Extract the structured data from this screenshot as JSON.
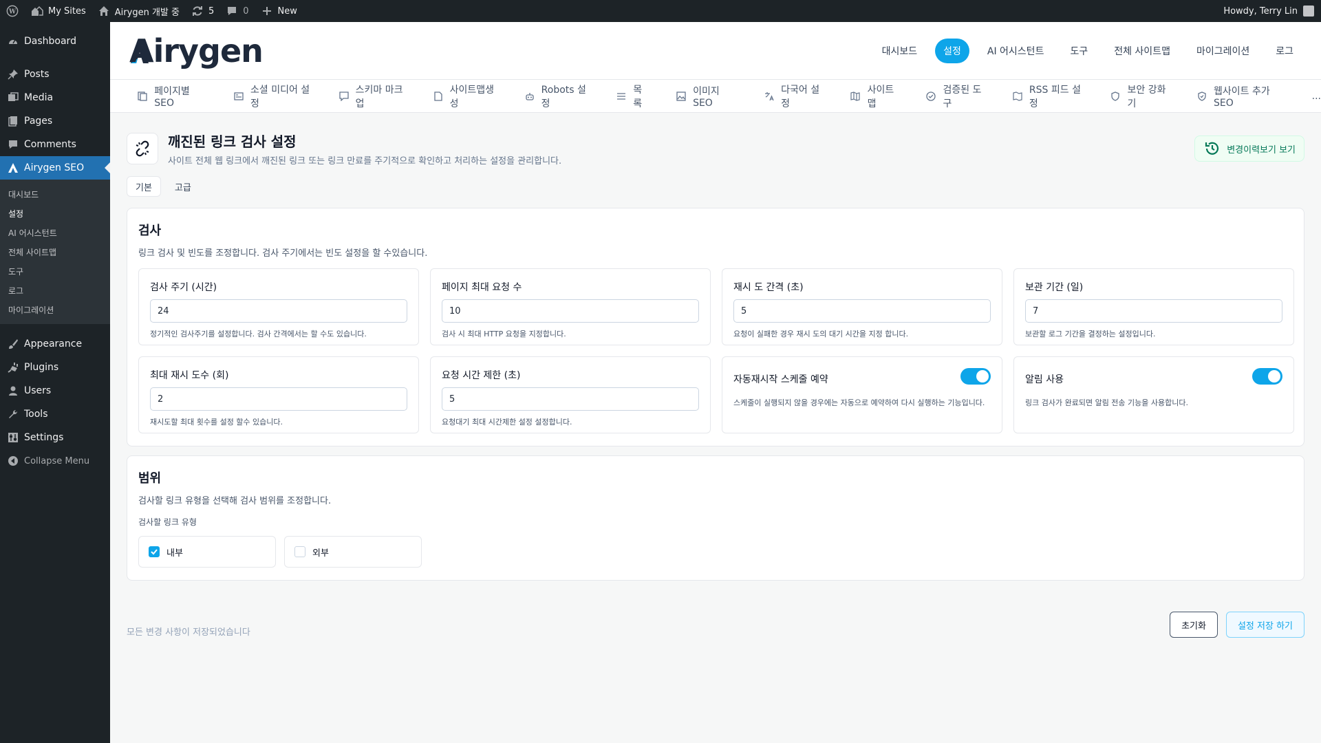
{
  "adminbar": {
    "my_sites": "My Sites",
    "site_name": "Airygen 개발 중",
    "updates_count": "5",
    "comments_count": "0",
    "new_label": "New",
    "howdy": "Howdy, Terry Lin"
  },
  "sidebar": {
    "items": [
      {
        "label": "Dashboard",
        "icon": "dashboard-icon"
      },
      {
        "label": "Posts",
        "icon": "pin-icon"
      },
      {
        "label": "Media",
        "icon": "media-icon"
      },
      {
        "label": "Pages",
        "icon": "page-icon"
      },
      {
        "label": "Comments",
        "icon": "comment-icon"
      },
      {
        "label": "Airygen SEO",
        "icon": "airygen-icon"
      }
    ],
    "submenu": [
      "대시보드",
      "설정",
      "AI 어시스턴트",
      "전체 사이트맵",
      "도구",
      "로그",
      "마이그레이션"
    ],
    "items_bottom": [
      {
        "label": "Appearance",
        "icon": "brush-icon"
      },
      {
        "label": "Plugins",
        "icon": "plugin-icon"
      },
      {
        "label": "Users",
        "icon": "user-icon"
      },
      {
        "label": "Tools",
        "icon": "wrench-icon"
      },
      {
        "label": "Settings",
        "icon": "settings-icon"
      },
      {
        "label": "Collapse Menu",
        "icon": "collapse-icon"
      }
    ]
  },
  "header": {
    "logo": "Airygen",
    "nav": [
      "대시보드",
      "설정",
      "AI 어시스턴트",
      "도구",
      "전체 사이트맵",
      "마이그레이션",
      "로그"
    ],
    "active_nav_index": 1
  },
  "tabs": [
    "페이지별 SEO",
    "소셜 미디어 설정",
    "스키마 마크업",
    "사이트맵생성",
    "Robots 설정",
    "목록",
    "이미지 SEO",
    "다국어 설정",
    "사이트맵",
    "검증된 도구",
    "RSS 피드 설정",
    "보안 강화기",
    "웹사이트 추가 SEO",
    "..."
  ],
  "page": {
    "title": "깨진된 링크 검사 설정",
    "description": "사이트 전체 웹 링크에서 깨진된 링크 또는 링크 만료를 주기적으로 확인하고 처리하는 설정을 관리합니다.",
    "history_button": "변경이력보기 보기"
  },
  "mode_tabs": [
    "기본",
    "고급"
  ],
  "scan_card": {
    "title": "검사",
    "description": "링크 검사 및 빈도를 조정합니다. 검사 주기에서는 빈도 설정을 할 수있습니다.",
    "fields": [
      {
        "label": "검사 주기 (시간)",
        "value": "24",
        "help": "정기적인 검사주기를 설정합니다. 검사 간격에서는 할 수도 있습니다."
      },
      {
        "label": "페이지 최대 요청 수",
        "value": "10",
        "help": "검사 시 최대 HTTP 요청을 지정합니다."
      },
      {
        "label": "재시 도 간격 (초)",
        "value": "5",
        "help": "요청이 실패한 경우 재시 도의 대기 시간을 지정 합니다."
      },
      {
        "label": "보관 기간 (일)",
        "value": "7",
        "help": "보관할 로그 기간을 결정하는 설정입니다."
      },
      {
        "label": "최대 재시 도수 (회)",
        "value": "2",
        "help": "재시도할 최대 횟수를 설정 할수 있습니다."
      },
      {
        "label": "요청 시간 제한 (초)",
        "value": "5",
        "help": "요청대기 최대 시간제한 설정 설정합니다."
      }
    ],
    "toggles": [
      {
        "label": "자동재시작 스케줄 예약",
        "help": "스케줄이 실행되지 않을 경우에는 자동으로 예약하여 다시 실행하는 기능입니다.",
        "on": true
      },
      {
        "label": "알림 사용",
        "help": "링크 검사가 완료되면 알림 전송 기능을 사용합니다.",
        "on": true
      }
    ]
  },
  "scope_card": {
    "title": "범위",
    "description": "검사할 링크 유형을 선택해 검사 범위를 조정합니다.",
    "sub_label": "검사할 링크 유형",
    "options": [
      {
        "label": "내부",
        "checked": true
      },
      {
        "label": "외부",
        "checked": false
      }
    ]
  },
  "footer": {
    "note": "모든 변경 사항이 저장되었습니다",
    "reset_button": "초기화",
    "save_button": "설정 저장 하기"
  }
}
